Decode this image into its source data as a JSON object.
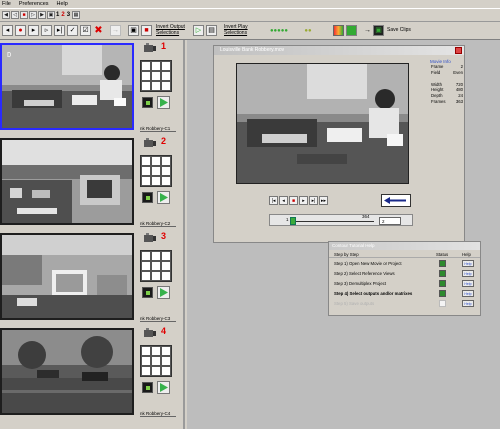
{
  "menu": [
    "File",
    "Preferences",
    "Help"
  ],
  "toolbar_top": {
    "numbers": [
      "1",
      "2",
      "3"
    ]
  },
  "toolbar": {
    "output_label": "Invert Output Selections",
    "play_label": "Invert Play Selections",
    "save_label": "Save Clips"
  },
  "cameras": [
    {
      "number": "1",
      "label": "nk Robbery-C1",
      "selected": true
    },
    {
      "number": "2",
      "label": "nk Robbery-C2",
      "selected": false
    },
    {
      "number": "3",
      "label": "nk Robbery-C3",
      "selected": false
    },
    {
      "number": "4",
      "label": "nk Robbery-C4",
      "selected": false
    }
  ],
  "main_window": {
    "title": "Louisville Bank Robbery.mov",
    "movie_info_title": "Movie Info",
    "info": [
      {
        "label": "Frame",
        "value": "2"
      },
      {
        "label": "Field",
        "value": "Even"
      },
      {
        "label": "Width",
        "value": "720"
      },
      {
        "label": "Height",
        "value": "480"
      },
      {
        "label": "Depth",
        "value": "24"
      },
      {
        "label": "Frames",
        "value": "363"
      }
    ],
    "slider": {
      "start": "1",
      "end": "364",
      "current": "2",
      "fraction": 0.003
    }
  },
  "help_window": {
    "title": "Contour Tutorial Help",
    "columns": {
      "step": "Step by Step",
      "status": "Status",
      "help": "Help"
    },
    "steps": [
      {
        "text": "Step 1) Open New Movie or Project",
        "done": true,
        "bold": false,
        "help": "Help"
      },
      {
        "text": "Step 2) Select Reference Views",
        "done": true,
        "bold": false,
        "help": "Help"
      },
      {
        "text": "Step 3) Demultiplex Project",
        "done": true,
        "bold": false,
        "help": "Help"
      },
      {
        "text": "Step 4) Select outputs and/or matrixes",
        "done": true,
        "bold": true,
        "help": "Help"
      },
      {
        "text": "Step 5) Save outputs",
        "done": false,
        "bold": false,
        "help": "Help"
      }
    ]
  },
  "colors": {
    "accent_red": "#e00000",
    "play_green": "#37b24d",
    "selection_blue": "#2a2aff",
    "link_blue": "#2a4cc8"
  }
}
